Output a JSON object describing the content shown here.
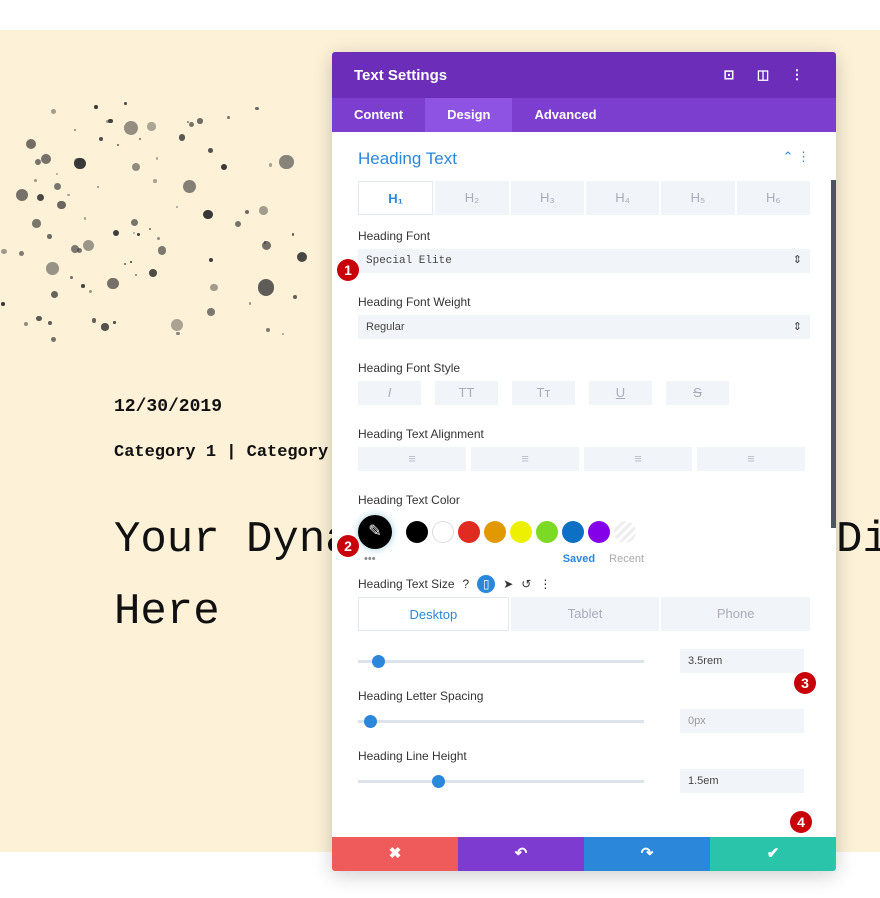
{
  "page": {
    "date": "12/30/2019",
    "categories": "Category 1 | Category 2",
    "heading_line1": "Your Dyna",
    "heading_tail": "Di",
    "heading_line2": "Here"
  },
  "panel": {
    "title": "Text Settings",
    "header_icons": [
      "screenshot-icon",
      "sidebar-layout-icon",
      "more-vertical-icon"
    ],
    "tabs": [
      {
        "label": "Content"
      },
      {
        "label": "Design",
        "active": true
      },
      {
        "label": "Advanced"
      }
    ],
    "section_title": "Heading Text",
    "heading_levels": [
      "H₁",
      "H₂",
      "H₃",
      "H₄",
      "H₅",
      "H₆"
    ],
    "font_label": "Heading Font",
    "font_value": "Special Elite",
    "weight_label": "Heading Font Weight",
    "weight_value": "Regular",
    "style_label": "Heading Font Style",
    "style_buttons": [
      "I",
      "TT",
      "Tт",
      "U",
      "S"
    ],
    "align_label": "Heading Text Alignment",
    "color_label": "Heading Text Color",
    "swatches": [
      "#000000",
      "#ffffff",
      "#e02b20",
      "#e09900",
      "#edf000",
      "#7cda24",
      "#0c71c3",
      "#8300e9"
    ],
    "saved": "Saved",
    "recent": "Recent",
    "size_label": "Heading Text Size",
    "devices": [
      "Desktop",
      "Tablet",
      "Phone"
    ],
    "text_size": "3.5rem",
    "text_size_fraction": 0.05,
    "spacing_label": "Heading Letter Spacing",
    "letter_spacing": "0px",
    "letter_spacing_fraction": 0.02,
    "lineheight_label": "Heading Line Height",
    "line_height": "1.5em",
    "line_height_fraction": 0.26,
    "badges": [
      "1",
      "2",
      "3",
      "4"
    ],
    "footer": {
      "cancel": "✖",
      "undo": "↶",
      "redo": "↷",
      "save": "✔"
    },
    "colors": {
      "header": "#6c2eb9",
      "tabs": "#7b3ecf",
      "accent": "#2b87da",
      "cancel": "#ef5a5a",
      "undo": "#7e3bd0",
      "redo": "#2b87da",
      "save": "#29c4a9"
    }
  }
}
